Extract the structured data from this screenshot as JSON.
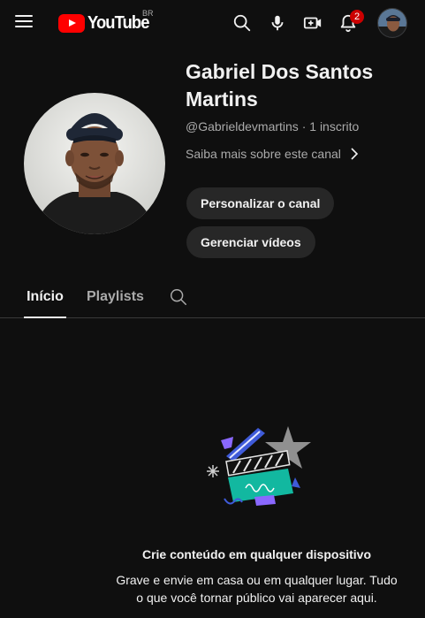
{
  "header": {
    "logo_text": "YouTube",
    "country_code": "BR",
    "notification_count": "2"
  },
  "channel": {
    "name": "Gabriel Dos Santos Martins",
    "handle": "@Gabrieldevmartins",
    "separator": " · ",
    "subscribers": "1 inscrito",
    "about_link": "Saiba mais sobre este canal",
    "customize_button": "Personalizar o canal",
    "manage_button": "Gerenciar vídeos"
  },
  "tabs": [
    {
      "label": "Início",
      "selected": true
    },
    {
      "label": "Playlists",
      "selected": false
    }
  ],
  "empty_state": {
    "title": "Crie conteúdo em qualquer dispositivo",
    "text": "Grave e envie em casa ou em qualquer lugar. Tudo o que você tornar público vai aparecer aqui."
  },
  "colors": {
    "background": "#0f0f0f",
    "brand_red": "#ff0000",
    "badge_red": "#cc0000",
    "pill_bg": "#272727",
    "secondary_text": "#aaaaaa"
  },
  "icons": [
    "menu-icon",
    "youtube-logo-icon",
    "search-icon",
    "microphone-icon",
    "create-video-icon",
    "notifications-bell-icon",
    "account-avatar",
    "chevron-right-icon",
    "tab-search-icon",
    "empty-state-illustration"
  ]
}
